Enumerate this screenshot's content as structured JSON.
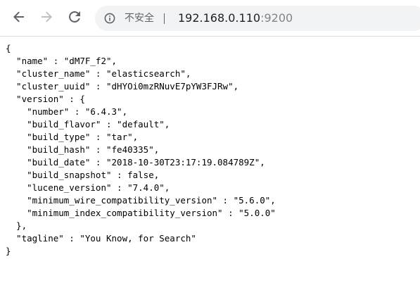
{
  "browser": {
    "security_label": "不安全",
    "url_host": "192.168.0.110",
    "url_port": ":9200",
    "icons": {
      "back": "back-arrow-icon",
      "forward": "forward-arrow-icon",
      "reload": "reload-icon",
      "info": "info-icon"
    },
    "colors": {
      "toolbar_bg": "#ffffff",
      "omnibox_bg": "#f1f3f4",
      "icon_active": "#5f6368",
      "icon_disabled": "#bdc1c6"
    }
  },
  "page": {
    "json_lines": [
      "{",
      "  \"name\" : \"dM7F_f2\",",
      "  \"cluster_name\" : \"elasticsearch\",",
      "  \"cluster_uuid\" : \"dHYOi0mzRNuvE7pYW3FJRw\",",
      "  \"version\" : {",
      "    \"number\" : \"6.4.3\",",
      "    \"build_flavor\" : \"default\",",
      "    \"build_type\" : \"tar\",",
      "    \"build_hash\" : \"fe40335\",",
      "    \"build_date\" : \"2018-10-30T23:17:19.084789Z\",",
      "    \"build_snapshot\" : false,",
      "    \"lucene_version\" : \"7.4.0\",",
      "    \"minimum_wire_compatibility_version\" : \"5.6.0\",",
      "    \"minimum_index_compatibility_version\" : \"5.0.0\"",
      "  },",
      "  \"tagline\" : \"You Know, for Search\"",
      "}"
    ]
  }
}
